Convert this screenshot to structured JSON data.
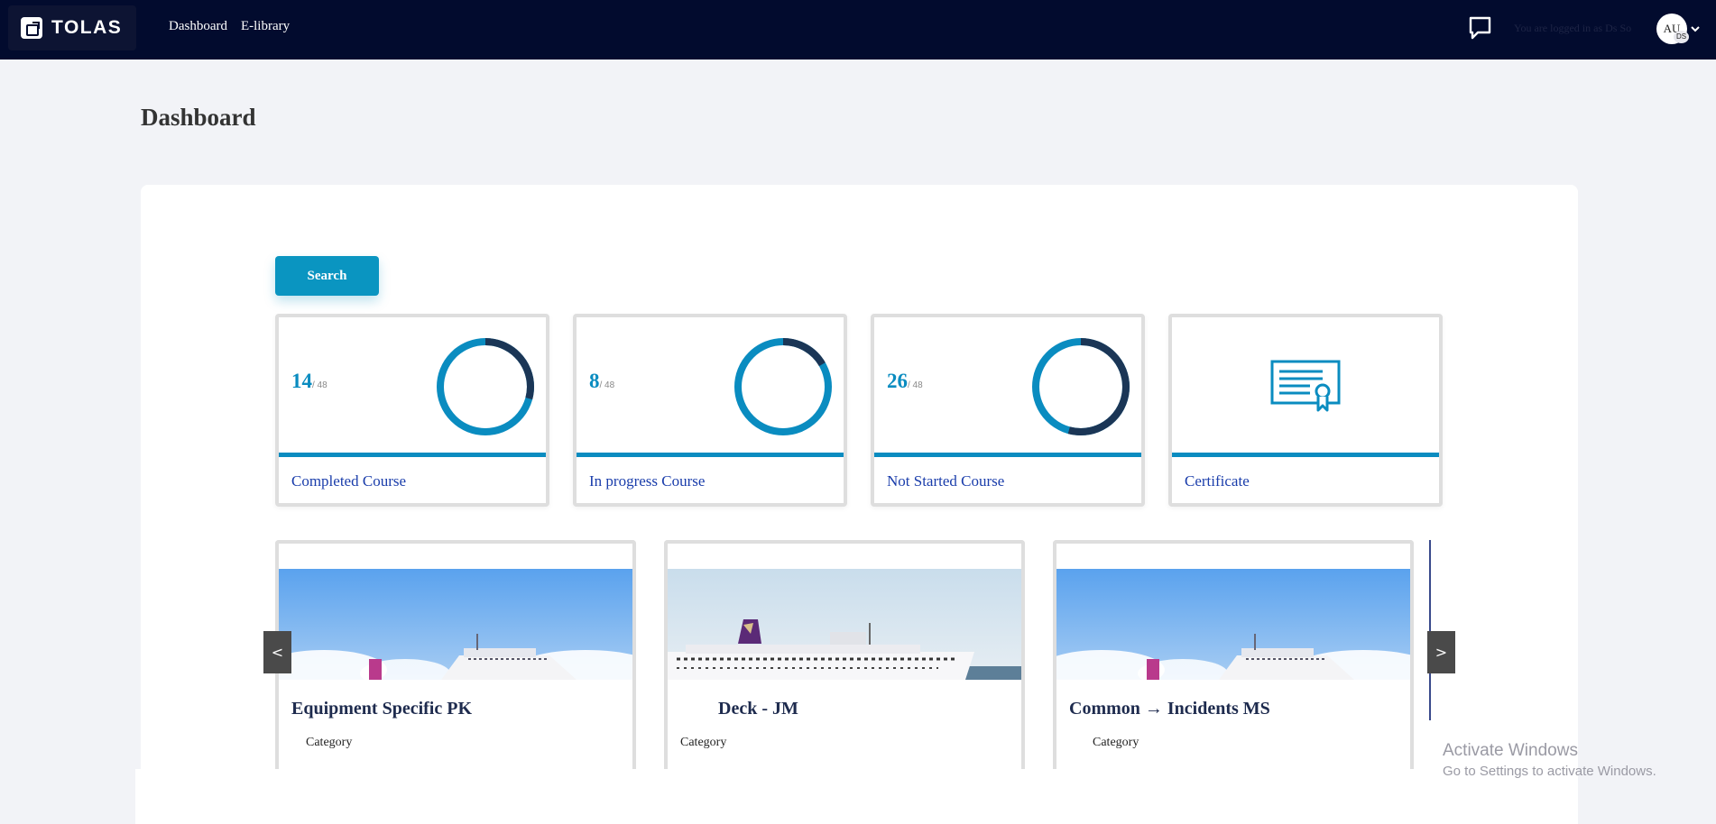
{
  "app": {
    "brand": "TOLAS"
  },
  "nav": {
    "links": [
      "Dashboard",
      "E-library"
    ]
  },
  "user": {
    "logged_in_text": "You are logged in as Ds So",
    "avatar_initials": "AU",
    "avatar_sub": "DS"
  },
  "page": {
    "title": "Dashboard"
  },
  "search": {
    "label": "Search"
  },
  "stats": [
    {
      "count": "14",
      "total": "/ 48",
      "label": "Completed Course",
      "fraction": 0.2917
    },
    {
      "count": "8",
      "total": "/ 48",
      "label": "In progress Course",
      "fraction": 0.1667
    },
    {
      "count": "26",
      "total": "/ 48",
      "label": "Not Started Course",
      "fraction": 0.5417
    },
    {
      "label": "Certificate"
    }
  ],
  "colors": {
    "accent": "#0a8cc0",
    "ring_dark": "#1b3656",
    "nav_bg": "#020b2e",
    "link": "#1a3dab"
  },
  "courses": [
    {
      "title": "Equipment Specific PK",
      "category": "Category"
    },
    {
      "title": "Deck - JM",
      "category": "Category"
    },
    {
      "title": "Common → Incidents MS",
      "category": "Category"
    }
  ],
  "carousel": {
    "prev": "<",
    "next": ">"
  },
  "watermark": {
    "title": "Activate Windows",
    "subtitle": "Go to Settings to activate Windows."
  }
}
